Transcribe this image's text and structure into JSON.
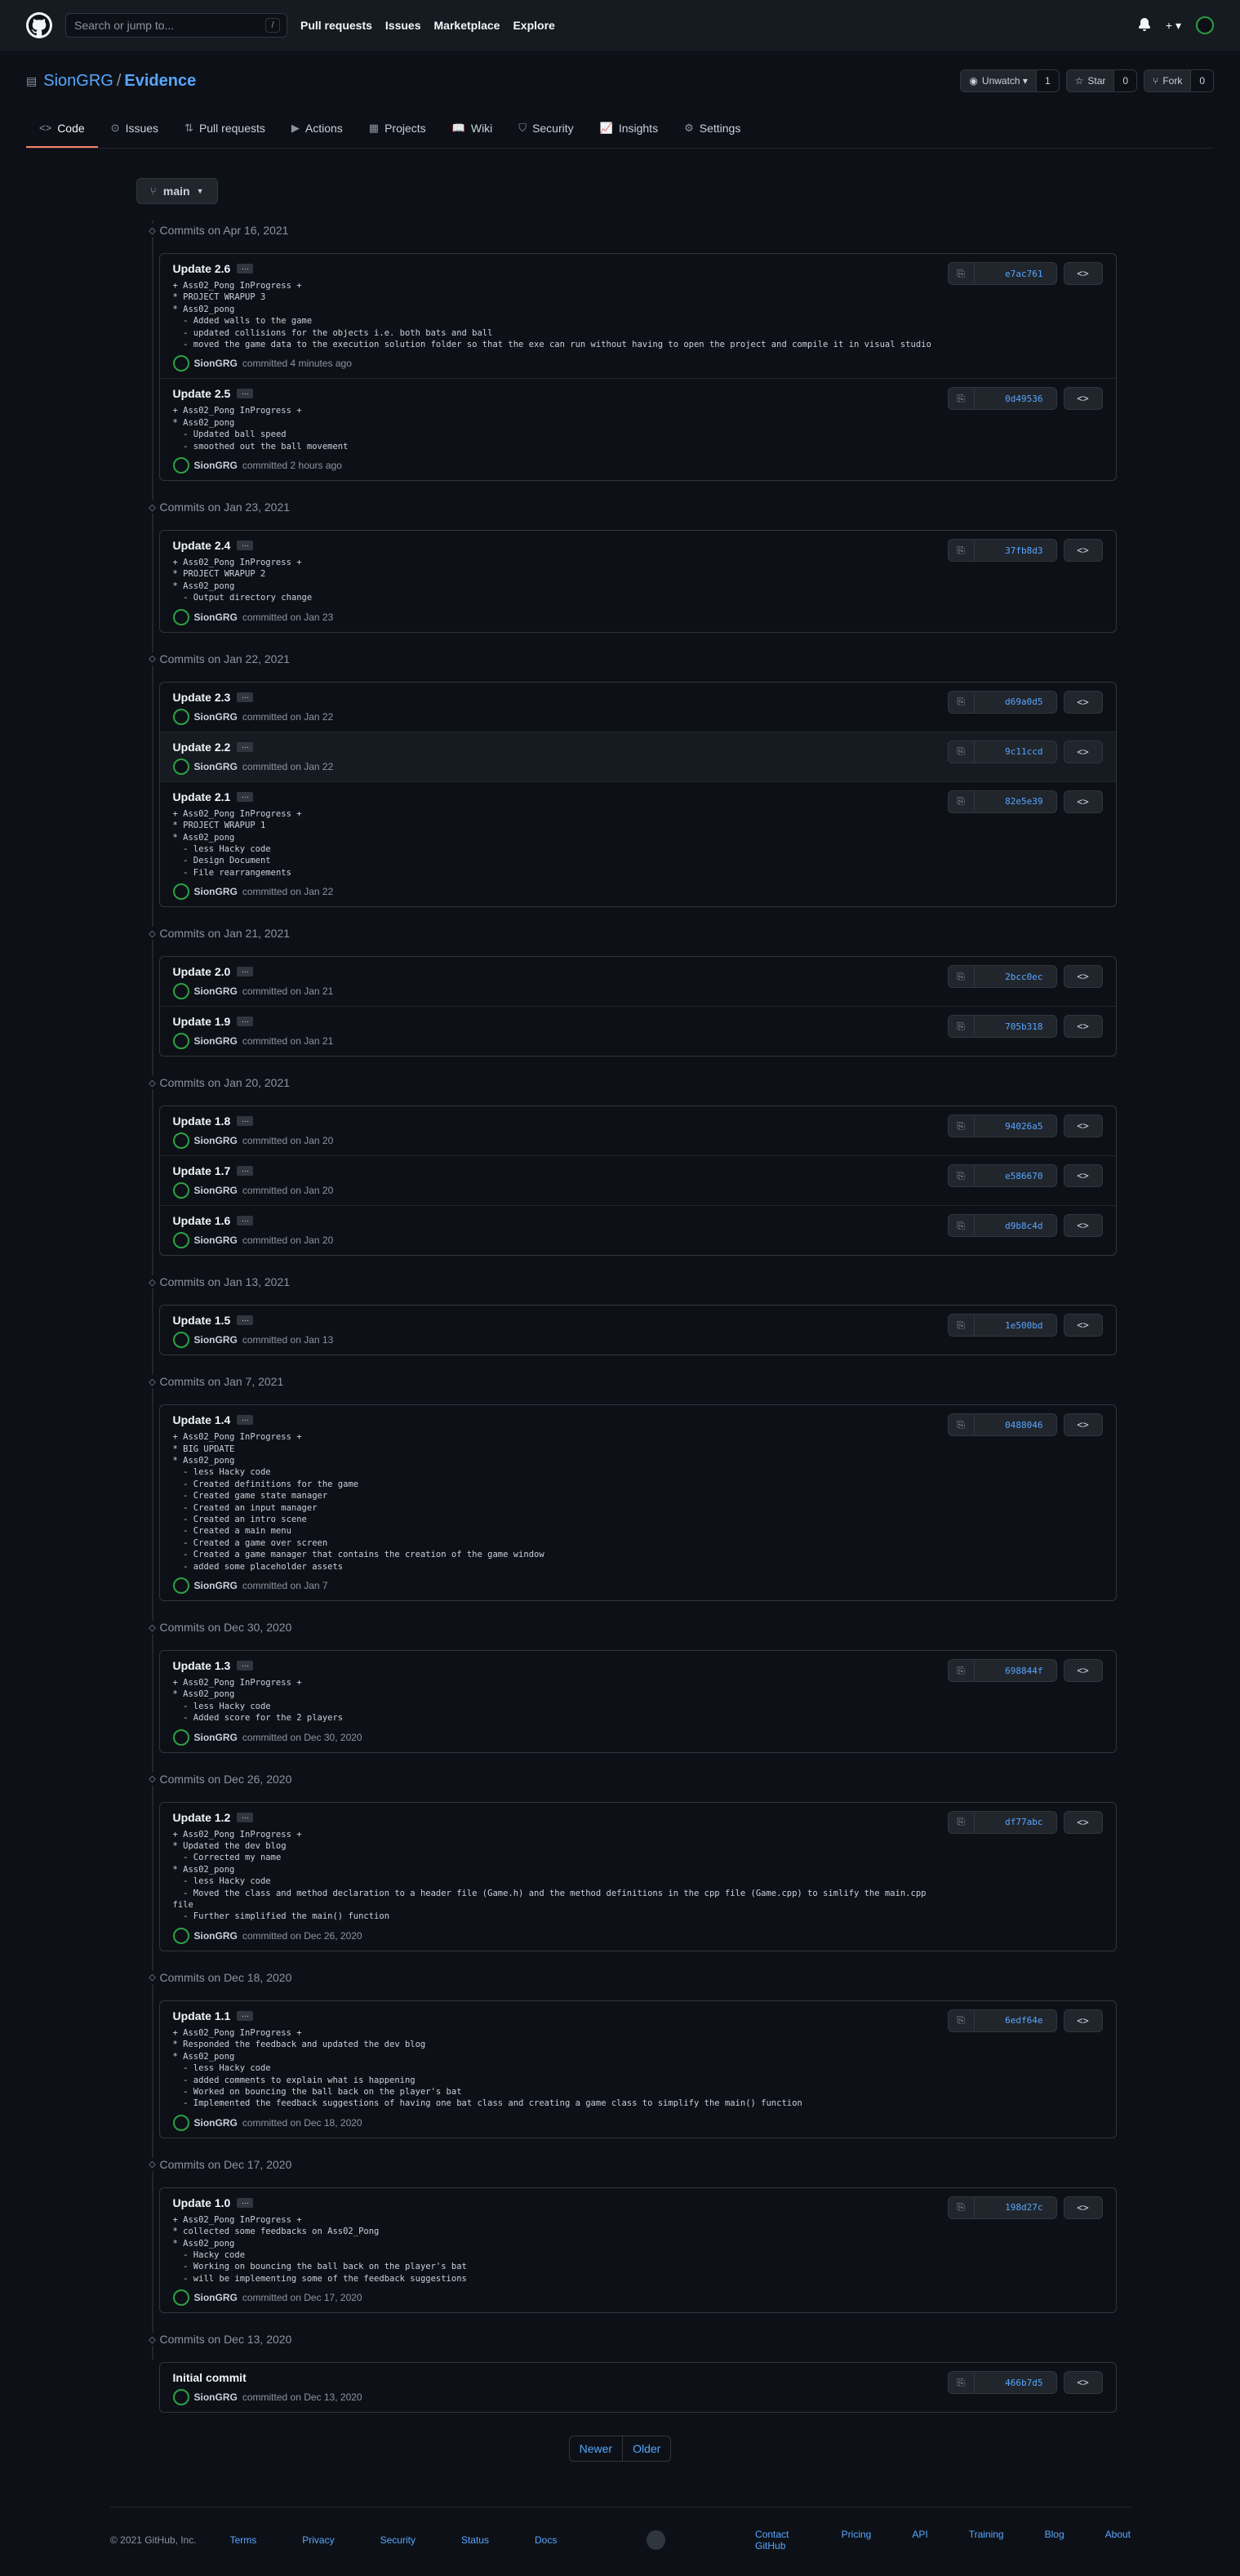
{
  "header": {
    "search_placeholder": "Search or jump to...",
    "search_key": "/",
    "nav": [
      "Pull requests",
      "Issues",
      "Marketplace",
      "Explore"
    ],
    "plus": "+ ▾",
    "bell": "🔔"
  },
  "repo": {
    "owner": "SionGRG",
    "name": "Evidence",
    "watch_label": "Unwatch ▾",
    "watch_count": "1",
    "star_label": "Star",
    "star_count": "0",
    "fork_label": "Fork",
    "fork_count": "0",
    "tabs": [
      {
        "label": "Code",
        "icon": "<>"
      },
      {
        "label": "Issues",
        "icon": "⊙"
      },
      {
        "label": "Pull requests",
        "icon": "⇅"
      },
      {
        "label": "Actions",
        "icon": "▶"
      },
      {
        "label": "Projects",
        "icon": "▦"
      },
      {
        "label": "Wiki",
        "icon": "📖"
      },
      {
        "label": "Security",
        "icon": "⛉"
      },
      {
        "label": "Insights",
        "icon": "📈"
      },
      {
        "label": "Settings",
        "icon": "⚙"
      }
    ]
  },
  "branch": {
    "name": "main"
  },
  "groups": [
    {
      "title": "Commits on Apr 16, 2021",
      "commits": [
        {
          "name": "Update 2.6",
          "sha": "e7ac761",
          "author": "SionGRG",
          "when": "committed 4 minutes ago",
          "desc": "+ Ass02_Pong InProgress +\n* PROJECT WRAPUP 3\n* Ass02_pong\n  - Added walls to the game\n  - updated collisions for the objects i.e. both bats and ball\n  - moved the game data to the execution solution folder so that the exe can run without having to open the project and compile it in visual studio"
        },
        {
          "name": "Update 2.5",
          "sha": "0d49536",
          "author": "SionGRG",
          "when": "committed 2 hours ago",
          "desc": "+ Ass02_Pong InProgress +\n* Ass02_pong\n  - Updated ball speed\n  - smoothed out the ball movement"
        }
      ]
    },
    {
      "title": "Commits on Jan 23, 2021",
      "commits": [
        {
          "name": "Update 2.4",
          "sha": "37fb8d3",
          "author": "SionGRG",
          "when": "committed on Jan 23",
          "desc": "+ Ass02_Pong InProgress +\n* PROJECT WRAPUP 2\n* Ass02_pong\n  - Output directory change"
        }
      ]
    },
    {
      "title": "Commits on Jan 22, 2021",
      "commits": [
        {
          "name": "Update 2.3",
          "sha": "d69a0d5",
          "author": "SionGRG",
          "when": "committed on Jan 22",
          "desc": ""
        },
        {
          "name": "Update 2.2",
          "sha": "9c11ccd",
          "author": "SionGRG",
          "when": "committed on Jan 22",
          "desc": "",
          "hl": true
        },
        {
          "name": "Update 2.1",
          "sha": "82e5e39",
          "author": "SionGRG",
          "when": "committed on Jan 22",
          "desc": "+ Ass02_Pong InProgress +\n* PROJECT WRAPUP 1\n* Ass02_pong\n  - less Hacky code\n  - Design Document\n  - File rearrangements"
        }
      ]
    },
    {
      "title": "Commits on Jan 21, 2021",
      "commits": [
        {
          "name": "Update 2.0",
          "sha": "2bcc0ec",
          "author": "SionGRG",
          "when": "committed on Jan 21",
          "desc": ""
        },
        {
          "name": "Update 1.9",
          "sha": "705b318",
          "author": "SionGRG",
          "when": "committed on Jan 21",
          "desc": ""
        }
      ]
    },
    {
      "title": "Commits on Jan 20, 2021",
      "commits": [
        {
          "name": "Update 1.8",
          "sha": "94026a5",
          "author": "SionGRG",
          "when": "committed on Jan 20",
          "desc": ""
        },
        {
          "name": "Update 1.7",
          "sha": "e586670",
          "author": "SionGRG",
          "when": "committed on Jan 20",
          "desc": ""
        },
        {
          "name": "Update 1.6",
          "sha": "d9b8c4d",
          "author": "SionGRG",
          "when": "committed on Jan 20",
          "desc": ""
        }
      ]
    },
    {
      "title": "Commits on Jan 13, 2021",
      "commits": [
        {
          "name": "Update 1.5",
          "sha": "1e500bd",
          "author": "SionGRG",
          "when": "committed on Jan 13",
          "desc": ""
        }
      ]
    },
    {
      "title": "Commits on Jan 7, 2021",
      "commits": [
        {
          "name": "Update 1.4",
          "sha": "0488046",
          "author": "SionGRG",
          "when": "committed on Jan 7",
          "desc": "+ Ass02_Pong InProgress +\n* BIG UPDATE\n* Ass02_pong\n  - less Hacky code\n  - Created definitions for the game\n  - Created game state manager\n  - Created an input manager\n  - Created an intro scene\n  - Created a main menu\n  - Created a game over screen\n  - Created a game manager that contains the creation of the game window\n  - added some placeholder assets"
        }
      ]
    },
    {
      "title": "Commits on Dec 30, 2020",
      "commits": [
        {
          "name": "Update 1.3",
          "sha": "698844f",
          "author": "SionGRG",
          "when": "committed on Dec 30, 2020",
          "desc": "+ Ass02_Pong InProgress +\n* Ass02_pong\n  - less Hacky code\n  - Added score for the 2 players"
        }
      ]
    },
    {
      "title": "Commits on Dec 26, 2020",
      "commits": [
        {
          "name": "Update 1.2",
          "sha": "df77abc",
          "author": "SionGRG",
          "when": "committed on Dec 26, 2020",
          "desc": "+ Ass02_Pong InProgress +\n* Updated the dev blog\n  - Corrected my name\n* Ass02_pong\n  - less Hacky code\n  - Moved the class and method declaration to a header file (Game.h) and the method definitions in the cpp file (Game.cpp) to simlify the main.cpp file\n  - Further simplified the main() function"
        }
      ]
    },
    {
      "title": "Commits on Dec 18, 2020",
      "commits": [
        {
          "name": "Update 1.1",
          "sha": "6edf64e",
          "author": "SionGRG",
          "when": "committed on Dec 18, 2020",
          "desc": "+ Ass02_Pong InProgress +\n* Responded the feedback and updated the dev blog\n* Ass02_pong\n  - less Hacky code\n  - added comments to explain what is happening\n  - Worked on bouncing the ball back on the player's bat\n  - Implemented the feedback suggestions of having one bat class and creating a game class to simplify the main() function"
        }
      ]
    },
    {
      "title": "Commits on Dec 17, 2020",
      "commits": [
        {
          "name": "Update 1.0",
          "sha": "198d27c",
          "author": "SionGRG",
          "when": "committed on Dec 17, 2020",
          "desc": "+ Ass02_Pong InProgress +\n* collected some feedbacks on Ass02_Pong\n* Ass02_pong\n  - Hacky code\n  - Working on bouncing the ball back on the player's bat\n  - will be implementing some of the feedback suggestions"
        }
      ]
    },
    {
      "title": "Commits on Dec 13, 2020",
      "commits": [
        {
          "name": "Initial commit",
          "sha": "466b7d5",
          "author": "SionGRG",
          "when": "committed on Dec 13, 2020",
          "desc": "",
          "nodots": true
        }
      ]
    }
  ],
  "pager": {
    "newer": "Newer",
    "older": "Older"
  },
  "footer": {
    "copyright": "© 2021 GitHub, Inc.",
    "left_links": [
      "Terms",
      "Privacy",
      "Security",
      "Status",
      "Docs"
    ],
    "right_links": [
      "Contact GitHub",
      "Pricing",
      "API",
      "Training",
      "Blog",
      "About"
    ]
  }
}
